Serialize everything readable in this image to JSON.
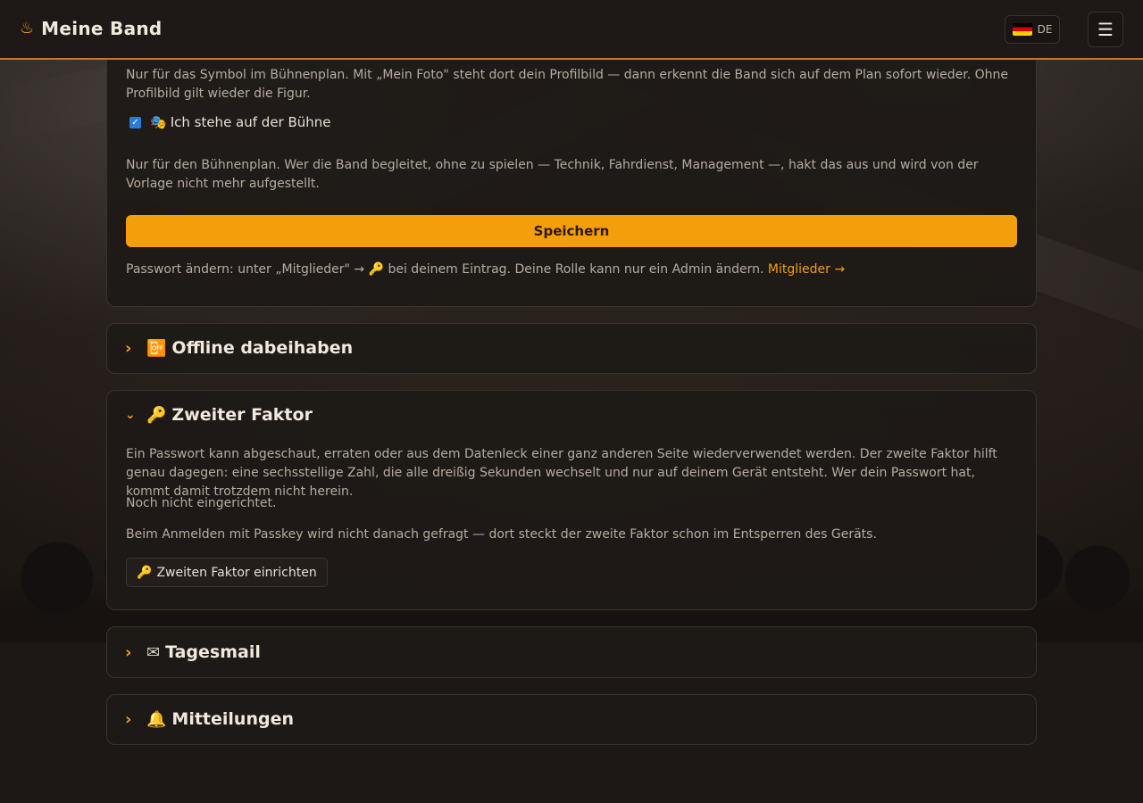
{
  "header": {
    "logo_glyph": "♨",
    "app_title": "Meine Band",
    "language_code": "DE",
    "menu_glyph": "☰"
  },
  "profile": {
    "symbol_help": "Nur für das Symbol im Bühnenplan. Mit „Mein Foto\" steht dort dein Profilbild — dann erkennt die Band sich auf dem Plan sofort wieder. Ohne Profilbild gilt wieder die Figur.",
    "on_stage_checked": true,
    "on_stage_icon": "🎭",
    "on_stage_label": "Ich stehe auf der Bühne",
    "on_stage_help": "Nur für den Bühnenplan. Wer die Band begleitet, ohne zu spielen — Technik, Fahrdienst, Management —, hakt das aus und wird von der Vorlage nicht mehr aufgestellt.",
    "save_label": "Speichern",
    "password_hint_prefix": "Passwort ändern: unter „Mitglieder\" → 🔑 bei deinem Eintrag. Deine Rolle kann nur ein Admin ändern.",
    "members_link": "Mitglieder →"
  },
  "sections": {
    "offline": {
      "icon": "📴",
      "title": "Offline dabeihaben",
      "expanded": false
    },
    "twofactor": {
      "icon": "🔑",
      "title": "Zweiter Faktor",
      "expanded": true,
      "intro": "Ein Passwort kann abgeschaut, erraten oder aus dem Datenleck einer ganz anderen Seite wiederverwendet werden. Der zweite Faktor hilft genau dagegen: eine sechsstellige Zahl, die alle dreißig Sekunden wechselt und nur auf deinem Gerät entsteht. Wer dein Passwort hat, kommt damit trotzdem nicht herein.",
      "status": "Noch nicht eingerichtet.",
      "passkey_note": "Beim Anmelden mit Passkey wird nicht danach gefragt — dort steckt der zweite Faktor schon im Entsperren des Geräts.",
      "setup_icon": "🔑",
      "setup_label": "Zweiten Faktor einrichten"
    },
    "dailymail": {
      "icon": "✉",
      "title": "Tagesmail",
      "expanded": false
    },
    "notifications": {
      "icon": "🔔",
      "title": "Mitteilungen",
      "expanded": false
    }
  },
  "colors": {
    "accent": "#f59e0b",
    "header_border": "#c7762a",
    "card_bg": "#1e1916",
    "text_muted": "#b6aca1"
  }
}
